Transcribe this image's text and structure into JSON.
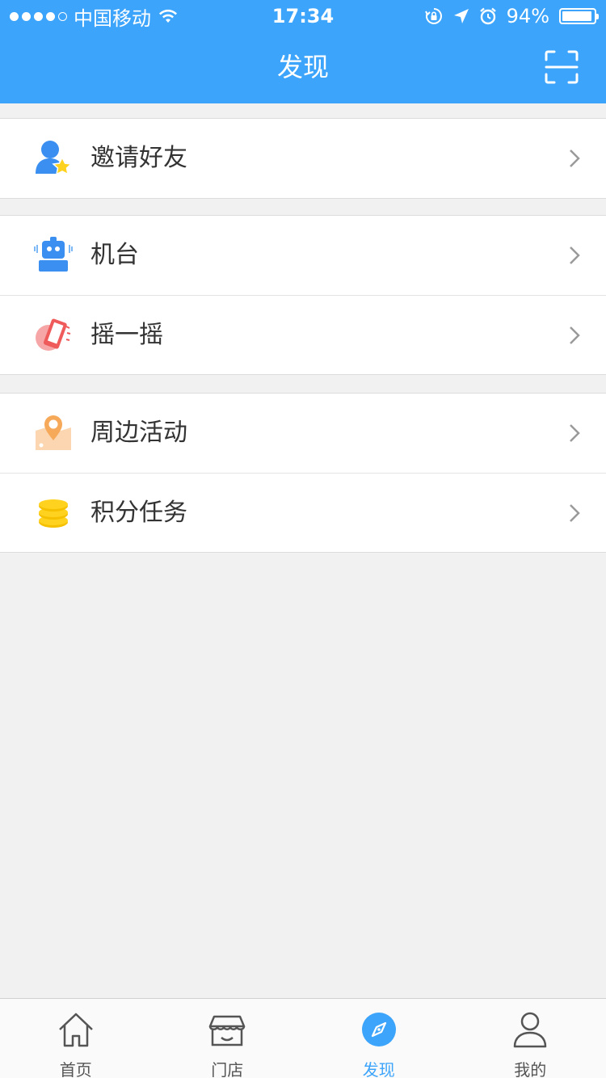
{
  "status_bar": {
    "carrier": "中国移动",
    "time": "17:34",
    "battery": "94%",
    "battery_level": 0.94,
    "signal_bars": 4,
    "signal_total": 5
  },
  "header": {
    "title": "发现",
    "scan_icon": "scan-icon"
  },
  "groups": [
    {
      "items": [
        {
          "label": "邀请好友",
          "icon": "invite-friend-icon"
        }
      ]
    },
    {
      "items": [
        {
          "label": "机台",
          "icon": "robot-machine-icon"
        },
        {
          "label": "摇一摇",
          "icon": "shake-phone-icon"
        }
      ]
    },
    {
      "items": [
        {
          "label": "周边活动",
          "icon": "map-pin-icon"
        },
        {
          "label": "积分任务",
          "icon": "coins-icon"
        }
      ]
    }
  ],
  "tabbar": {
    "tabs": [
      {
        "label": "首页",
        "icon": "home-icon",
        "active": false
      },
      {
        "label": "门店",
        "icon": "store-icon",
        "active": false
      },
      {
        "label": "发现",
        "icon": "compass-icon",
        "active": true
      },
      {
        "label": "我的",
        "icon": "user-icon",
        "active": false
      }
    ]
  },
  "colors": {
    "brand": "#3ca4fb",
    "background": "#f1f1f1",
    "text": "#333333"
  }
}
